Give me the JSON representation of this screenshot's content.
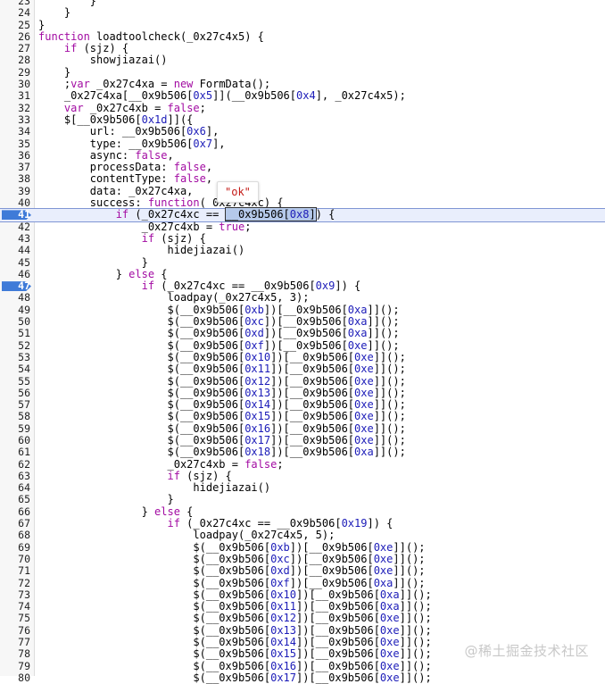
{
  "lines": [
    {
      "n": "23",
      "code": "        }"
    },
    {
      "n": "24",
      "code": "    }"
    },
    {
      "n": "25",
      "code": "}"
    },
    {
      "n": "26",
      "code": "function loadtoolcheck(_0x27c4x5) {"
    },
    {
      "n": "27",
      "code": "    if (sjz) {"
    },
    {
      "n": "28",
      "code": "        showjiazai()"
    },
    {
      "n": "29",
      "code": "    }"
    },
    {
      "n": "30",
      "code": "    ;var _0x27c4xa = new FormData();"
    },
    {
      "n": "31",
      "code": "    _0x27c4xa[__0x9b506[0x5]](__0x9b506[0x4], _0x27c4x5);"
    },
    {
      "n": "32",
      "code": "    var _0x27c4xb = false;"
    },
    {
      "n": "33",
      "code": "    $[__0x9b506[0x1d]]({"
    },
    {
      "n": "34",
      "code": "        url: __0x9b506[0x6],"
    },
    {
      "n": "35",
      "code": "        type: __0x9b506[0x7],"
    },
    {
      "n": "36",
      "code": "        async: false,"
    },
    {
      "n": "37",
      "code": "        processData: false,"
    },
    {
      "n": "38",
      "code": "        contentType: false,"
    },
    {
      "n": "39",
      "code": "        data: _0x27c4xa,"
    },
    {
      "n": "40",
      "code": "        success: function(_0x27c4xc) {"
    },
    {
      "n": "41",
      "code": "            if (_0x27c4xc == __0x9b506[0x8]) {",
      "active": true,
      "bp": true
    },
    {
      "n": "42",
      "code": "                _0x27c4xb = true;"
    },
    {
      "n": "43",
      "code": "                if (sjz) {"
    },
    {
      "n": "44",
      "code": "                    hidejiazai()"
    },
    {
      "n": "45",
      "code": "                }"
    },
    {
      "n": "46",
      "code": "            } else {"
    },
    {
      "n": "47",
      "code": "                if (_0x27c4xc == __0x9b506[0x9]) {",
      "bp": true
    },
    {
      "n": "48",
      "code": "                    loadpay(_0x27c4x5, 3);"
    },
    {
      "n": "49",
      "code": "                    $(__0x9b506[0xb])[__0x9b506[0xa]]();"
    },
    {
      "n": "50",
      "code": "                    $(__0x9b506[0xc])[__0x9b506[0xa]]();"
    },
    {
      "n": "51",
      "code": "                    $(__0x9b506[0xd])[__0x9b506[0xa]]();"
    },
    {
      "n": "52",
      "code": "                    $(__0x9b506[0xf])[__0x9b506[0xe]]();"
    },
    {
      "n": "53",
      "code": "                    $(__0x9b506[0x10])[__0x9b506[0xe]]();"
    },
    {
      "n": "54",
      "code": "                    $(__0x9b506[0x11])[__0x9b506[0xe]]();"
    },
    {
      "n": "55",
      "code": "                    $(__0x9b506[0x12])[__0x9b506[0xe]]();"
    },
    {
      "n": "56",
      "code": "                    $(__0x9b506[0x13])[__0x9b506[0xe]]();"
    },
    {
      "n": "57",
      "code": "                    $(__0x9b506[0x14])[__0x9b506[0xe]]();"
    },
    {
      "n": "58",
      "code": "                    $(__0x9b506[0x15])[__0x9b506[0xe]]();"
    },
    {
      "n": "59",
      "code": "                    $(__0x9b506[0x16])[__0x9b506[0xe]]();"
    },
    {
      "n": "60",
      "code": "                    $(__0x9b506[0x17])[__0x9b506[0xe]]();"
    },
    {
      "n": "61",
      "code": "                    $(__0x9b506[0x18])[__0x9b506[0xa]]();"
    },
    {
      "n": "62",
      "code": "                    _0x27c4xb = false;"
    },
    {
      "n": "63",
      "code": "                    if (sjz) {"
    },
    {
      "n": "64",
      "code": "                        hidejiazai()"
    },
    {
      "n": "65",
      "code": "                    }"
    },
    {
      "n": "66",
      "code": "                } else {"
    },
    {
      "n": "67",
      "code": "                    if (_0x27c4xc == __0x9b506[0x19]) {"
    },
    {
      "n": "68",
      "code": "                        loadpay(_0x27c4x5, 5);"
    },
    {
      "n": "69",
      "code": "                        $(__0x9b506[0xb])[__0x9b506[0xe]]();"
    },
    {
      "n": "70",
      "code": "                        $(__0x9b506[0xc])[__0x9b506[0xe]]();"
    },
    {
      "n": "71",
      "code": "                        $(__0x9b506[0xd])[__0x9b506[0xe]]();"
    },
    {
      "n": "72",
      "code": "                        $(__0x9b506[0xf])[__0x9b506[0xa]]();"
    },
    {
      "n": "73",
      "code": "                        $(__0x9b506[0x10])[__0x9b506[0xa]]();"
    },
    {
      "n": "74",
      "code": "                        $(__0x9b506[0x11])[__0x9b506[0xa]]();"
    },
    {
      "n": "75",
      "code": "                        $(__0x9b506[0x12])[__0x9b506[0xe]]();"
    },
    {
      "n": "76",
      "code": "                        $(__0x9b506[0x13])[__0x9b506[0xe]]();"
    },
    {
      "n": "77",
      "code": "                        $(__0x9b506[0x14])[__0x9b506[0xe]]();"
    },
    {
      "n": "78",
      "code": "                        $(__0x9b506[0x15])[__0x9b506[0xe]]();"
    },
    {
      "n": "79",
      "code": "                        $(__0x9b506[0x16])[__0x9b506[0xe]]();"
    },
    {
      "n": "80",
      "code": "                        $(__0x9b506[0x17])[__0x9b506[0xe]]();"
    }
  ],
  "tooltip": "\"ok\"",
  "watermark": "@稀土掘金技术社区",
  "colors": {
    "keyword": "#a20ba2",
    "hex_literal": "#1c1cb8",
    "string": "#c41a16",
    "breakpoint": "#3f7bd8",
    "active_line": "#e9eefc"
  }
}
